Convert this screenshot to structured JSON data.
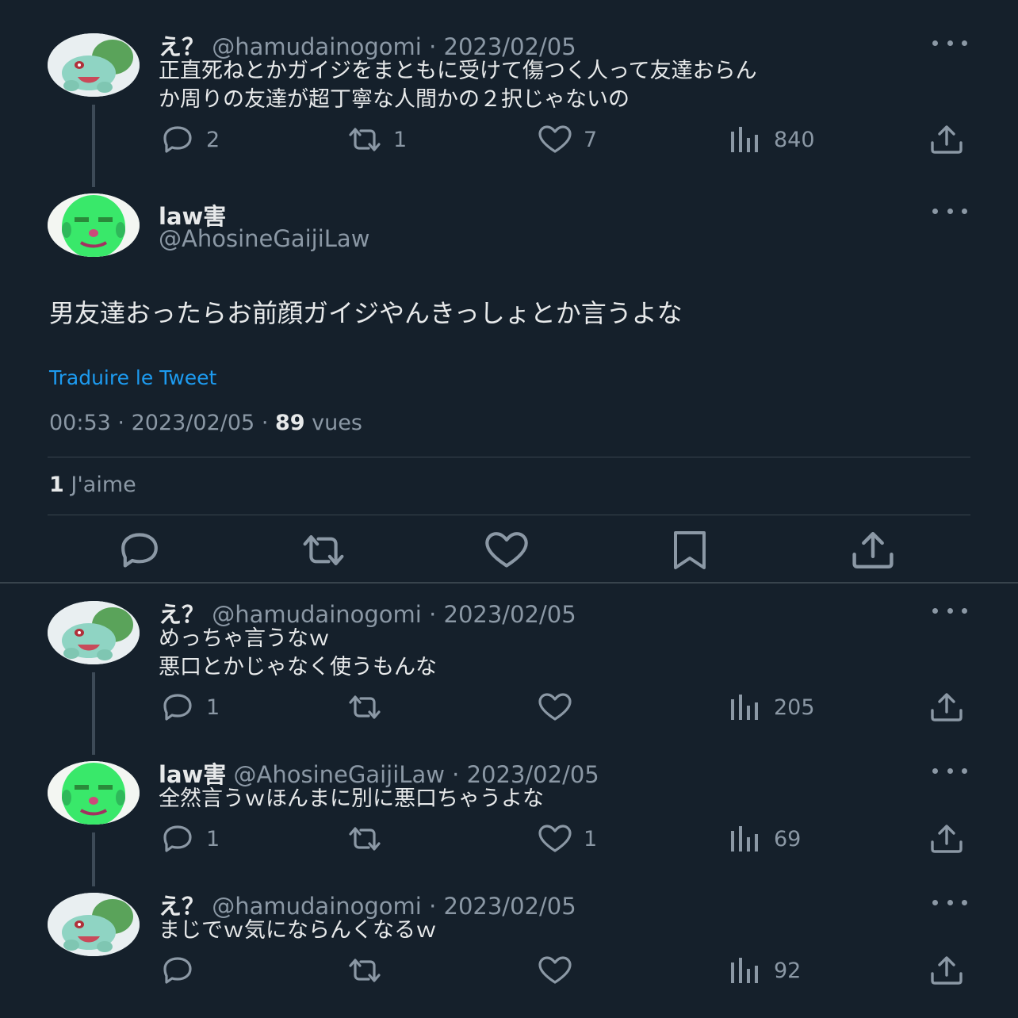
{
  "tweets_top": {
    "name": "え？",
    "handle": "@hamudainogomi",
    "date": "2023/02/05",
    "line1": "正直死ねとかガイジをまともに受けて傷つく人って友達おらん",
    "line2": "か周りの友達が超丁寧な人間かの２択じゃないの",
    "replies": "2",
    "retweets": "1",
    "likes": "7",
    "views": "840"
  },
  "main": {
    "name": "law害",
    "handle": "@AhosineGaijiLaw",
    "text": "男友達おったらお前顔ガイジやんきっしょとか言うよな",
    "translate": "Traduire le Tweet",
    "time": "00:53",
    "date": "2023/02/05",
    "views_count": "89",
    "views_label": "vues",
    "likes_count": "1",
    "likes_label": "J'aime"
  },
  "replies": [
    {
      "name": "え？",
      "handle": "@hamudainogomi",
      "date": "2023/02/05",
      "line1": "めっちゃ言うなｗ",
      "line2": "悪口とかじゃなく使うもんな",
      "replies": "1",
      "retweets": "",
      "likes": "",
      "views": "205"
    },
    {
      "name": "law害",
      "handle": "@AhosineGaijiLaw",
      "date": "2023/02/05",
      "line1": "全然言うｗほんまに別に悪口ちゃうよな",
      "line2": "",
      "replies": "1",
      "retweets": "",
      "likes": "1",
      "views": "69"
    },
    {
      "name": "え？",
      "handle": "@hamudainogomi",
      "date": "2023/02/05",
      "line1": "まじでｗ気にならんくなるｗ",
      "line2": "",
      "replies": "",
      "retweets": "",
      "likes": "",
      "views": "92"
    }
  ],
  "separator": "·",
  "icons": {
    "reply": "speech-bubble-icon",
    "retweet": "retweet-arrows-icon",
    "like": "heart-icon",
    "views": "bar-chart-icon",
    "share": "share-upload-icon",
    "bookmark": "bookmark-icon",
    "more": "more-dots-icon"
  },
  "colors": {
    "background": "#15202b",
    "text": "#e7e9ea",
    "muted": "#8b98a5",
    "link": "#1d9bf0",
    "border": "#38444d"
  }
}
